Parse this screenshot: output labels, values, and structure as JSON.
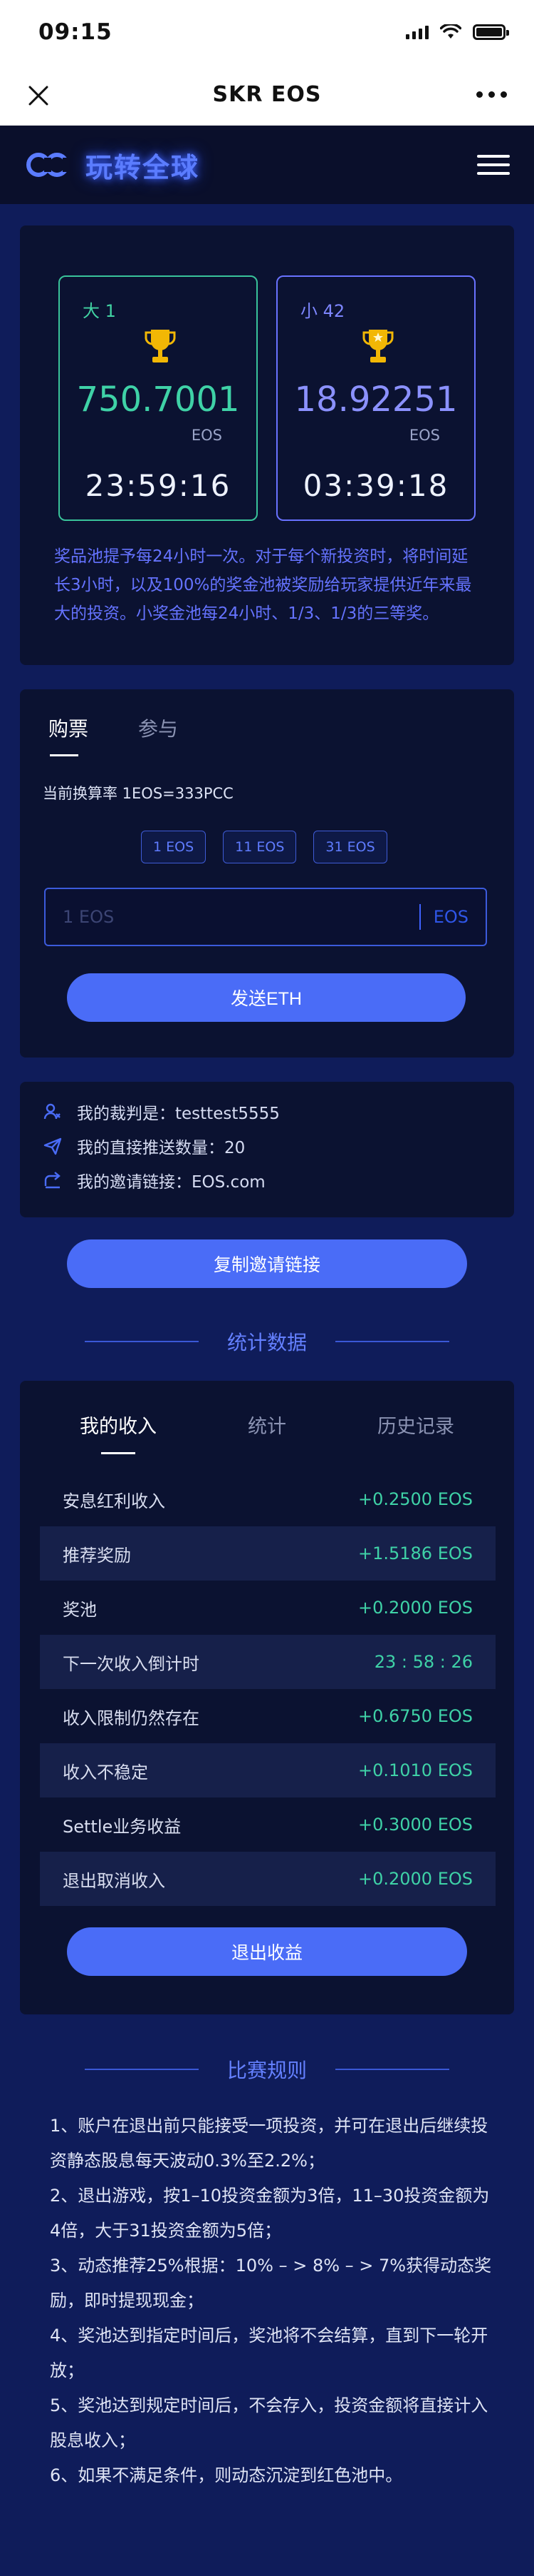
{
  "status": {
    "time": "09:15"
  },
  "nav": {
    "title": "SKR EOS"
  },
  "brand": {
    "name": "玩转全球",
    "accent": "#4a6cf7"
  },
  "pools": [
    {
      "label": "大 1",
      "amount": "750.7001",
      "unit": "EOS",
      "timer": "23:59:16",
      "color": "#3fd2a7"
    },
    {
      "label": "小 42",
      "amount": "18.92251",
      "unit": "EOS",
      "timer": "03:39:18",
      "color": "#8b91ff"
    }
  ],
  "pool_description": "奖品池提予每24小时一次。对于每个新投资时，将时间延长3小时，以及100%的奖金池被奖励给玩家提供近年来最大的投资。小奖金池每24小时、1/3、1/3的三等奖。",
  "buy": {
    "tabs": [
      "购票",
      "参与"
    ],
    "rate": "当前换算率 1EOS=333PCC",
    "chips": [
      "1 EOS",
      "11 EOS",
      "31 EOS"
    ],
    "input_placeholder": "1 EOS",
    "input_unit": "EOS",
    "submit": "发送ETH"
  },
  "info": {
    "referee": "我的裁判是：testtest5555",
    "direct_count": "我的直接推送数量：20",
    "invite_link": "我的邀请链接：EOS.com"
  },
  "copy_button": "复制邀请链接",
  "stats": {
    "title": "统计数据",
    "tabs": [
      "我的收入",
      "统计",
      "历史记录"
    ],
    "rows": [
      {
        "label": "安息红利收入",
        "value": "+0.2500 EOS"
      },
      {
        "label": "推荐奖励",
        "value": "+1.5186 EOS"
      },
      {
        "label": "奖池",
        "value": "+0.2000 EOS"
      },
      {
        "label": "下一次收入倒计时",
        "value": "23 : 58 : 26"
      },
      {
        "label": "收入限制仍然存在",
        "value": "+0.6750 EOS"
      },
      {
        "label": "收入不稳定",
        "value": "+0.1010 EOS"
      },
      {
        "label": "Settle业务收益",
        "value": "+0.3000 EOS"
      },
      {
        "label": "退出取消收入",
        "value": "+0.2000 EOS"
      }
    ],
    "exit_button": "退出收益"
  },
  "rules": {
    "title": "比赛规则",
    "items": [
      "1、账户在退出前只能接受一项投资，并可在退出后继续投资静态股息每天波动0.3%至2.2%；",
      "2、退出游戏，按1–10投资金额为3倍，11–30投资金额为4倍，大于31投资金额为5倍；",
      "3、动态推荐25%根据：10% – > 8% – > 7%获得动态奖励，即时提现现金；",
      "4、奖池达到指定时间后，奖池将不会结算，直到下一轮开放；",
      "5、奖池达到规定时间后，不会存入，投资金额将直接计入股息收入；",
      "6、如果不满足条件，则动态沉淀到红色池中。"
    ]
  }
}
